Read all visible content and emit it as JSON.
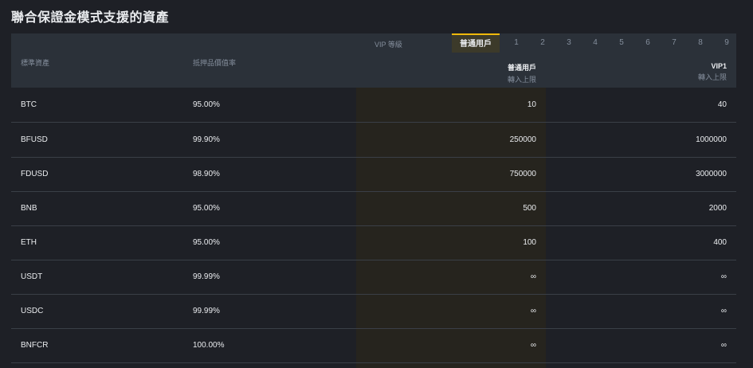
{
  "page": {
    "title": "聯合保證金模式支援的資產"
  },
  "header": {
    "asset_col": "標準資產",
    "ratio_col": "抵押品價值率",
    "vip_level_label": "VIP 等級",
    "tiers": [
      "普通用戶",
      "1",
      "2",
      "3",
      "4",
      "5",
      "6",
      "7",
      "8",
      "9"
    ],
    "active_tier": "普通用戶",
    "normal_col_title": "普通用戶",
    "normal_col_sub": "轉入上限",
    "vip1_col_title": "VIP1",
    "vip1_col_sub": "轉入上限"
  },
  "colors": {
    "accent": "#f0b90b",
    "background": "#1e2026",
    "header_bg": "#2b3139"
  },
  "rows": [
    {
      "asset": "BTC",
      "ratio": "95.00%",
      "normal": "10",
      "vip1": "40"
    },
    {
      "asset": "BFUSD",
      "ratio": "99.90%",
      "normal": "250000",
      "vip1": "1000000"
    },
    {
      "asset": "FDUSD",
      "ratio": "98.90%",
      "normal": "750000",
      "vip1": "3000000"
    },
    {
      "asset": "BNB",
      "ratio": "95.00%",
      "normal": "500",
      "vip1": "2000"
    },
    {
      "asset": "ETH",
      "ratio": "95.00%",
      "normal": "100",
      "vip1": "400"
    },
    {
      "asset": "USDT",
      "ratio": "99.99%",
      "normal": "∞",
      "vip1": "∞"
    },
    {
      "asset": "USDC",
      "ratio": "99.99%",
      "normal": "∞",
      "vip1": "∞"
    },
    {
      "asset": "BNFCR",
      "ratio": "100.00%",
      "normal": "∞",
      "vip1": "∞"
    }
  ]
}
